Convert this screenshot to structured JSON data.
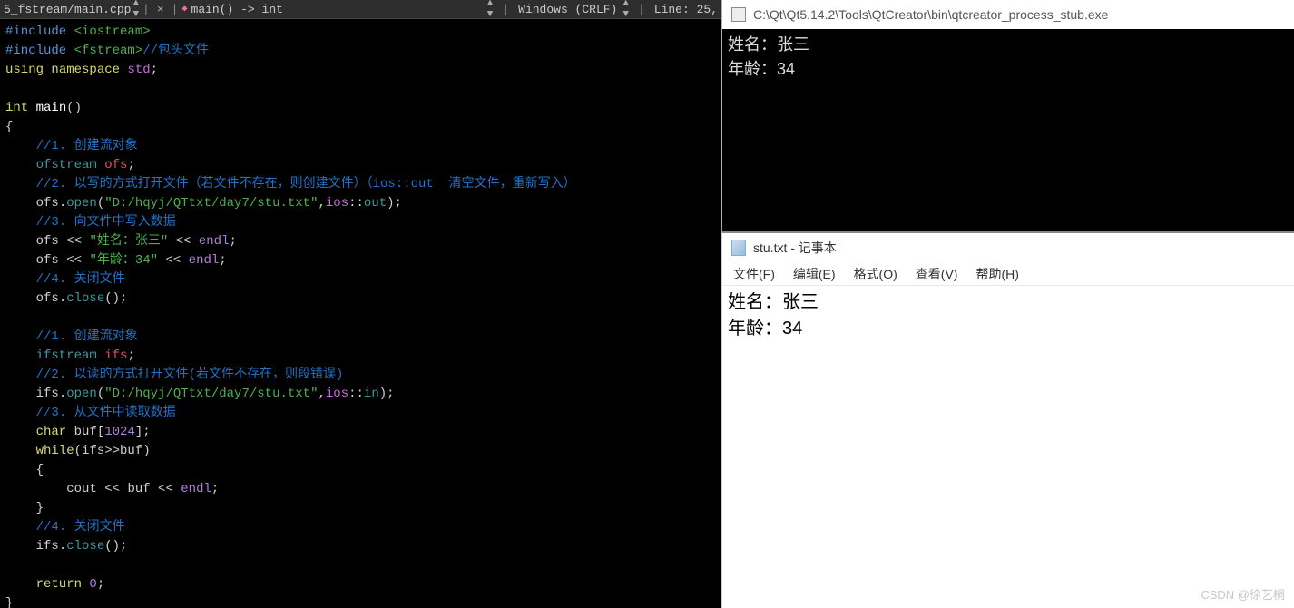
{
  "toolbar": {
    "file_path": "5_fstream/main.cpp",
    "breadcrumb_func": "main() -> int",
    "encoding": "Windows (CRLF)",
    "line_info": "Line: 25,"
  },
  "code": {
    "l1a": "#include ",
    "l1b": "<iostream>",
    "l2a": "#include ",
    "l2b": "<fstream>",
    "l2c": "//包头文件",
    "l3a": "using ",
    "l3b": "namespace ",
    "l3c": "std",
    "l3d": ";",
    "l5a": "int ",
    "l5b": "main",
    "l5c": "()",
    "l6": "{",
    "l7": "    //1. 创建流对象",
    "l8a": "    ofstream ",
    "l8b": "ofs",
    "l8c": ";",
    "l9": "    //2. 以写的方式打开文件（若文件不存在，则创建文件）（ios::out  清空文件，重新写入）",
    "l10a": "    ofs",
    "l10b": ".",
    "l10c": "open",
    "l10d": "(",
    "l10e": "\"D:/hqyj/QTtxt/day7/stu.txt\"",
    "l10f": ",",
    "l10g": "ios",
    "l10h": "::",
    "l10i": "out",
    "l10j": ");",
    "l11": "    //3. 向文件中写入数据",
    "l12a": "    ofs ",
    "l12b": "<< ",
    "l12c": "\"姓名：张三\" ",
    "l12d": "<< ",
    "l12e": "endl",
    "l12f": ";",
    "l13a": "    ofs ",
    "l13b": "<< ",
    "l13c": "\"年龄：34\" ",
    "l13d": "<< ",
    "l13e": "endl",
    "l13f": ";",
    "l14": "    //4. 关闭文件",
    "l15a": "    ofs",
    "l15b": ".",
    "l15c": "close",
    "l15d": "();",
    "l17": "    //1. 创建流对象",
    "l18a": "    ifstream ",
    "l18b": "ifs",
    "l18c": ";",
    "l19": "    //2. 以读的方式打开文件(若文件不存在，则段错误)",
    "l20a": "    ifs",
    "l20b": ".",
    "l20c": "open",
    "l20d": "(",
    "l20e": "\"D:/hqyj/QTtxt/day7/stu.txt\"",
    "l20f": ",",
    "l20g": "ios",
    "l20h": "::",
    "l20i": "in",
    "l20j": ");",
    "l21": "    //3. 从文件中读取数据",
    "l22a": "    char ",
    "l22b": "buf",
    "l22c": "[",
    "l22d": "1024",
    "l22e": "];",
    "l23a": "    while",
    "l23b": "(ifs>>buf)",
    "l24": "    {",
    "l25a": "        cout ",
    "l25b": "<< ",
    "l25c": "buf ",
    "l25d": "<< ",
    "l25e": "endl",
    "l25f": ";",
    "l26": "    }",
    "l27": "    //4. 关闭文件",
    "l28a": "    ifs",
    "l28b": ".",
    "l28c": "close",
    "l28d": "();",
    "l30a": "    return ",
    "l30b": "0",
    "l30c": ";",
    "l31": "}"
  },
  "console": {
    "title": "C:\\Qt\\Qt5.14.2\\Tools\\QtCreator\\bin\\qtcreator_process_stub.exe",
    "line1": "姓名：张三",
    "line2": "年龄：34"
  },
  "notepad": {
    "title": "stu.txt - 记事本",
    "menu": {
      "file": "文件(F)",
      "edit": "编辑(E)",
      "format": "格式(O)",
      "view": "查看(V)",
      "help": "帮助(H)"
    },
    "line1": "姓名：张三",
    "line2": "年龄：34"
  },
  "watermark": "CSDN @徐艺桐"
}
